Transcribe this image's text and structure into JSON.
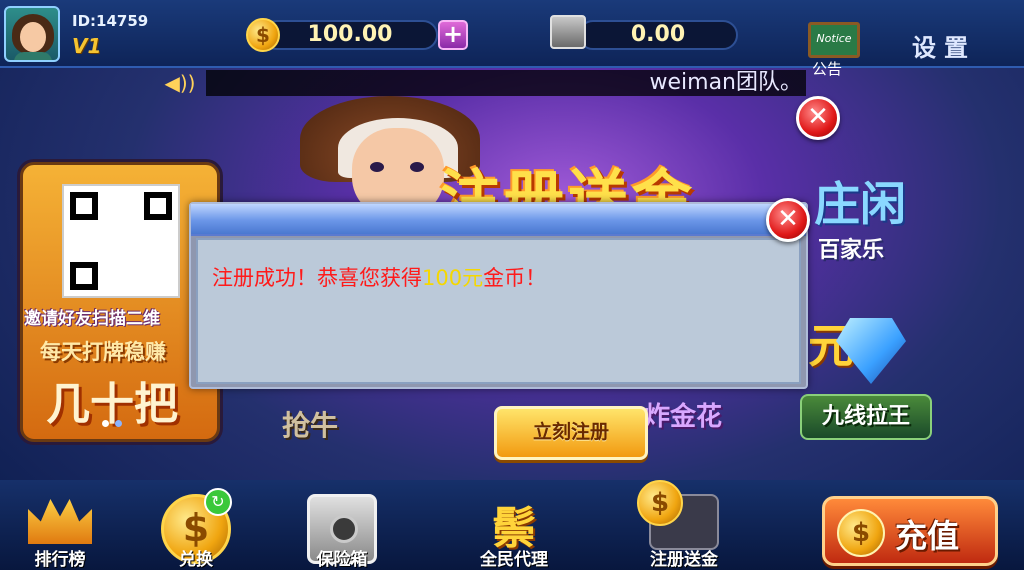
{
  "header": {
    "user_id": "ID:14759",
    "vip_level": "V1",
    "gold_balance": "100.00",
    "gold_add_label": "+",
    "bank_balance": "0.00",
    "notice_board_text": "Notice",
    "notice_label": "公告",
    "settings_label": "设置"
  },
  "marquee": {
    "text": "weiman团队。"
  },
  "banner": {
    "title": "注册送金"
  },
  "promo_card": {
    "line1": "邀请好友扫描二维",
    "line2": "每天打牌稳赚",
    "line3": "几十把"
  },
  "games": {
    "baijiale_big": "庄闲",
    "baijiale": "百家乐",
    "yuan": "元",
    "jiuxian": "九线拉王",
    "jinhua": "炸金花",
    "niuniu": "抢牛"
  },
  "register_button": {
    "label": "立刻注册"
  },
  "modal": {
    "message_prefix": "注册成功！恭喜您获得",
    "amount": "100元",
    "message_suffix": "金币！",
    "close_symbol": "✕"
  },
  "bottom_nav": {
    "items": [
      {
        "label": "排行榜",
        "icon": "crown-icon"
      },
      {
        "label": "兑换",
        "icon": "coin-exchange-icon"
      },
      {
        "label": "保险箱",
        "icon": "safe-icon"
      },
      {
        "label": "全民代理",
        "icon": "agent-icon"
      },
      {
        "label": "注册送金",
        "icon": "register-gift-icon"
      }
    ],
    "recharge_label": "充值"
  },
  "colors": {
    "modal_text": "#ff1a1a",
    "modal_amount": "#f5d800",
    "gold": "#ffd54a"
  }
}
